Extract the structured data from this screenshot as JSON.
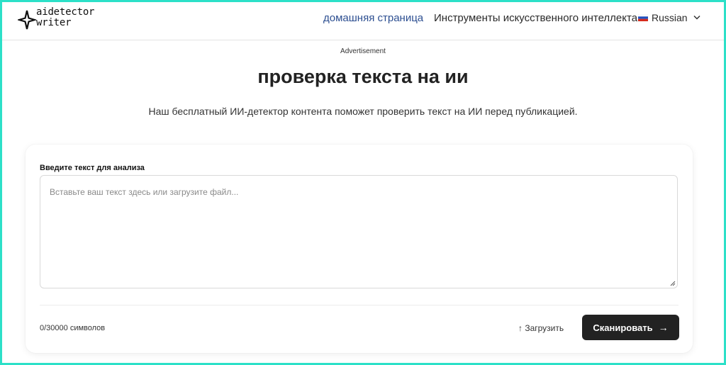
{
  "header": {
    "logo": {
      "line1": "aidetector",
      "line2": "writer"
    },
    "nav": {
      "home": "домашняя страница",
      "tools": "Инструменты искусственного интеллекта"
    },
    "language": "Russian"
  },
  "ad_label": "Advertisement",
  "hero": {
    "title": "проверка текста на ии",
    "subtitle": "Наш бесплатный ИИ-детектор контента поможет проверить текст на ИИ перед публикацией."
  },
  "form": {
    "label": "Введите текст для анализа",
    "placeholder": "Вставьте ваш текст здесь или загрузите файл...",
    "value": "",
    "counter": "0/30000 символов",
    "upload_icon": "upload-arrow-icon",
    "upload_glyph": "↑",
    "upload_label": "Загрузить",
    "scan_label": "Сканировать",
    "scan_arrow": "→"
  },
  "colors": {
    "accent_border": "#2ce0c8",
    "nav_active": "#2d4f91",
    "button_bg": "#222222"
  }
}
